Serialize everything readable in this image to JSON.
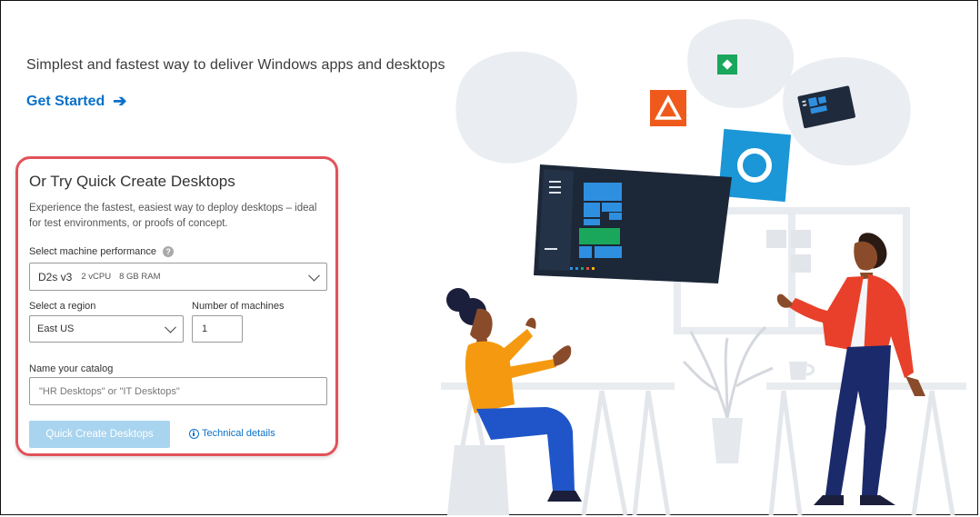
{
  "tagline": "Simplest and fastest way to deliver Windows apps and desktops",
  "get_started": {
    "label": "Get Started",
    "icon": "arrow-right-icon"
  },
  "quick_create": {
    "title": "Or Try Quick Create Desktops",
    "description": "Experience the fastest, easiest way to deploy desktops – ideal for test environments, or proofs of concept.",
    "performance": {
      "label": "Select machine performance",
      "selected_name": "D2s v3",
      "selected_cpu": "2 vCPU",
      "selected_ram": "8 GB RAM"
    },
    "region": {
      "label": "Select a region",
      "value": "East US"
    },
    "machines": {
      "label": "Number of machines",
      "value": "1"
    },
    "catalog": {
      "label": "Name your catalog",
      "placeholder": "\"HR Desktops\" or \"IT Desktops\""
    },
    "submit_label": "Quick Create Desktops",
    "technical_details_label": "Technical details"
  },
  "colors": {
    "accent": "#0a71c9",
    "highlight_border": "#e2525a",
    "button_disabled": "#a8d4ef",
    "person_left_shirt": "#f59a10",
    "person_right_jacket": "#e8402a"
  }
}
